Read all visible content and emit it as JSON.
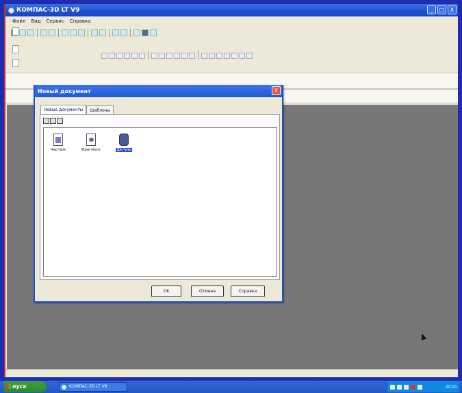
{
  "app": {
    "title": "КОМПАС-3D LT V9",
    "window_controls": [
      "_",
      "□",
      "X"
    ]
  },
  "menu": [
    "Файл",
    "Вид",
    "Сервис",
    "Справка"
  ],
  "dialog": {
    "title": "Новый документ",
    "close_label": "X",
    "tabs": [
      "Новые документы",
      "Шаблоны"
    ],
    "items": [
      {
        "label": "Чертеж",
        "icon": "drawing-document-icon",
        "selected": false
      },
      {
        "label": "Фрагмент",
        "icon": "fragment-document-icon",
        "selected": false
      },
      {
        "label": "Деталь",
        "icon": "part-document-icon",
        "selected": true
      }
    ],
    "buttons": {
      "ok": "OK",
      "cancel": "Отмена",
      "help": "Справка"
    }
  },
  "taskbar": {
    "start_label": "пуск",
    "task_label": "КОМПАС-3D LT V9",
    "time": "20:21"
  },
  "colors": {
    "titlebar": "#1f4fd0",
    "workspace": "#777777",
    "selection": "#2a4fc0",
    "taskbar": "#2457c4",
    "start": "#2d8a2a"
  }
}
